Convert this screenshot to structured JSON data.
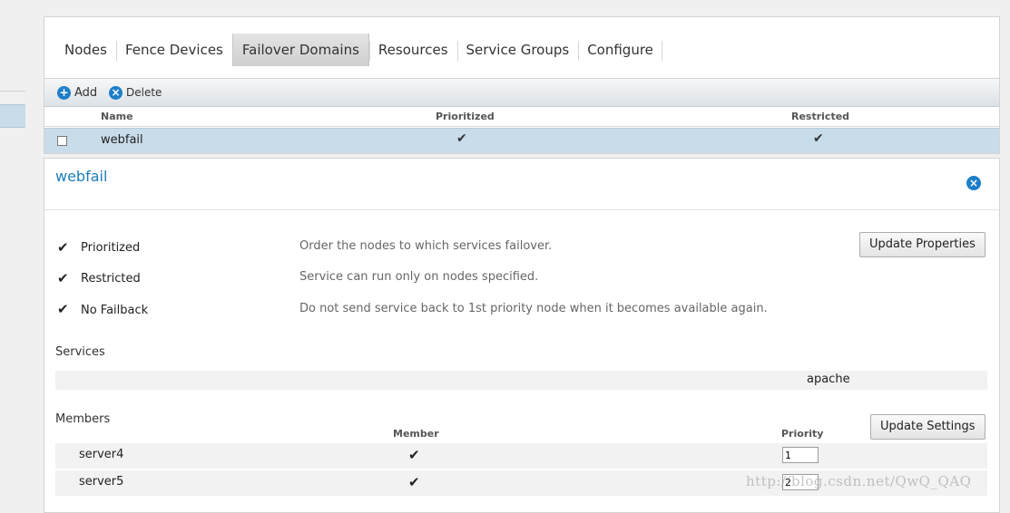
{
  "tabs": [
    {
      "label": "Nodes"
    },
    {
      "label": "Fence Devices"
    },
    {
      "label": "Failover Domains",
      "active": true
    },
    {
      "label": "Resources"
    },
    {
      "label": "Service Groups"
    },
    {
      "label": "Configure"
    }
  ],
  "toolbar": {
    "add_label": "Add",
    "delete_label": "Delete",
    "add_icon": "plus-icon",
    "delete_icon": "close-icon"
  },
  "grid": {
    "columns": {
      "name": "Name",
      "prioritized": "Prioritized",
      "restricted": "Restricted"
    },
    "rows": [
      {
        "name": "webfail",
        "prioritized": "✔",
        "restricted": "✔",
        "selected": true
      }
    ]
  },
  "details": {
    "title": "webfail",
    "options": [
      {
        "label": "Prioritized",
        "checked": true,
        "description": "Order the nodes to which services failover."
      },
      {
        "label": "Restricted",
        "checked": true,
        "description": "Service can run only on nodes specified."
      },
      {
        "label": "No Failback",
        "checked": true,
        "description": "Do not send service back to 1st priority node when it becomes available again."
      }
    ],
    "update_properties_label": "Update Properties",
    "services_label": "Services",
    "services": [
      "apache"
    ],
    "members_label": "Members",
    "member_col": "Member",
    "priority_col": "Priority",
    "update_settings_label": "Update Settings",
    "members": [
      {
        "name": "server4",
        "member": "✔",
        "priority": "1"
      },
      {
        "name": "server5",
        "member": "✔",
        "priority": "2"
      }
    ]
  },
  "watermark": "http://blog.csdn.net/QwQ_QAQ",
  "colors": {
    "accent": "#1e7ec8",
    "selected_row": "#c9dcea",
    "title": "#1d7fb8"
  }
}
